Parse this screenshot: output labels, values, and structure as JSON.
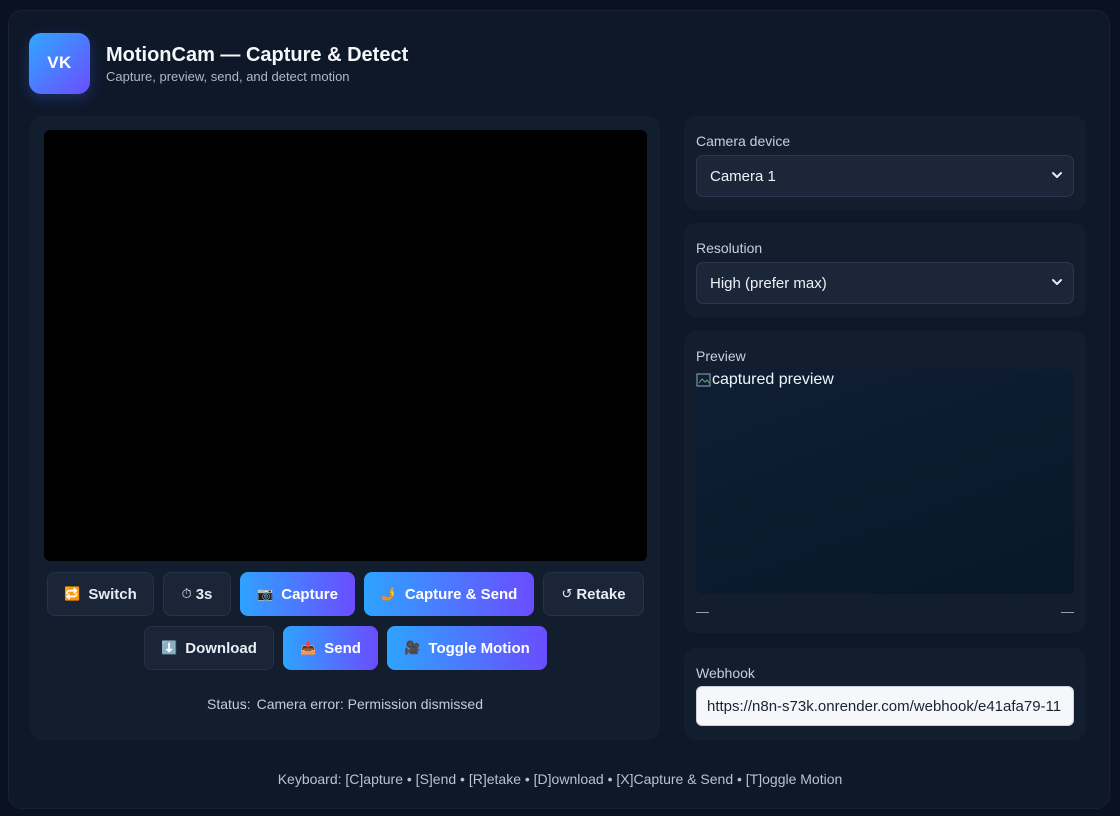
{
  "header": {
    "logo_text": "VK",
    "title": "MotionCam — Capture & Detect",
    "subtitle": "Capture, preview, send, and detect motion"
  },
  "controls": {
    "switch_label": "Switch",
    "timer_label": "3s",
    "capture_label": "Capture",
    "capture_send_label": "Capture & Send",
    "retake_label": "Retake",
    "download_label": "Download",
    "send_label": "Send",
    "toggle_motion_label": "Toggle Motion"
  },
  "status": {
    "label": "Status:",
    "text": "Camera error: Permission dismissed"
  },
  "camera": {
    "label": "Camera device",
    "selected": "Camera 1"
  },
  "resolution": {
    "label": "Resolution",
    "selected": "High (prefer max)"
  },
  "preview": {
    "label": "Preview",
    "alt_text": "captured preview",
    "meta_left": "—",
    "meta_right": "—"
  },
  "webhook": {
    "label": "Webhook",
    "value": "https://n8n-s73k.onrender.com/webhook/e41afa79-11"
  },
  "footer": {
    "shortcuts": "Keyboard: [C]apture • [S]end • [R]etake • [D]ownload • [X]Capture & Send • [T]oggle Motion"
  },
  "colors": {
    "accent_start": "#2ea3ff",
    "accent_end": "#6a4dff",
    "background": "#0a1120",
    "panel": "#121d2e"
  }
}
